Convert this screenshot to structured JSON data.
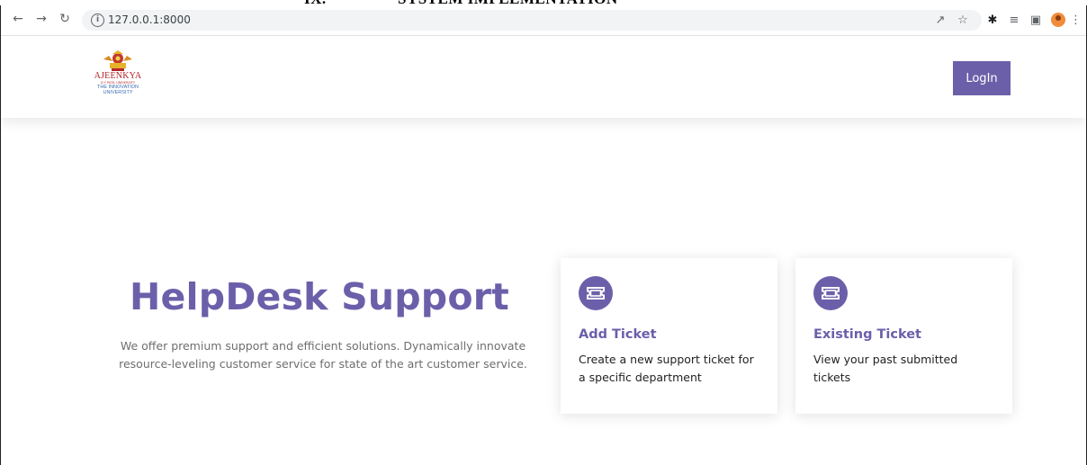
{
  "document": {
    "section_number": "IX.",
    "section_title": "SYSTEM IMPLEMENTATION"
  },
  "browser": {
    "url": "127.0.0.1:8000",
    "nav_icons": [
      "back-arrow-icon",
      "forward-arrow-icon",
      "reload-icon"
    ],
    "toolbar_icons": [
      "share-icon",
      "star-icon",
      "extensions-icon",
      "reading-list-icon",
      "side-panel-icon",
      "profile-icon",
      "menu-icon"
    ]
  },
  "header": {
    "logo": {
      "name": "AJEENKYA",
      "subtitle": "D Y PATIL UNIVERSITY",
      "tagline_1": "THE INNOVATION",
      "tagline_2": "UNIVERSITY"
    },
    "login_label": "LogIn"
  },
  "hero": {
    "title": "HelpDesk Support",
    "description": "We offer premium support and efficient solutions. Dynamically innovate resource-leveling customer service for state of the art customer service."
  },
  "cards": [
    {
      "icon": "ticket-icon",
      "title": "Add Ticket",
      "text": "Create a new support ticket for a specific department"
    },
    {
      "icon": "ticket-icon",
      "title": "Existing Ticket",
      "text": "View your past submitted tickets"
    }
  ],
  "colors": {
    "accent": "#6c5faa",
    "logo_red": "#b3262b",
    "logo_blue": "#3a6db3"
  }
}
